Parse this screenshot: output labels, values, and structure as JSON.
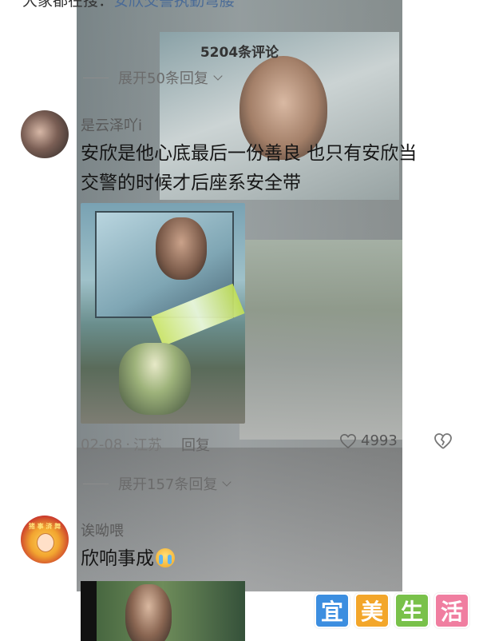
{
  "top_clip": {
    "prefix": "大家都在搜：",
    "query": "安欣交警执勤弯腰"
  },
  "panel": {
    "title": "5204条评论"
  },
  "expand_top": {
    "label": "展开50条回复"
  },
  "comments": [
    {
      "username": "是云泽吖i",
      "text_line1": "安欣是他心底最后一份善良 也只有安欣当",
      "text_line2": "交警的时候才后座系安全带",
      "date": "02-08",
      "location": "江苏",
      "reply_label": "回复",
      "likes": "4993",
      "expand_label": "展开157条回复"
    },
    {
      "username": "诶呦喂",
      "text": "欣响事成",
      "avatar_text": "猪 事 済 舞"
    }
  ],
  "watermark": [
    "宜",
    "美",
    "生",
    "活"
  ],
  "colors": {
    "search_highlight": "#4a6b97",
    "watermark_1": "#3c8ee0",
    "watermark_2": "#f3a62a",
    "watermark_3": "#79c14a",
    "watermark_4": "#f07ea0"
  }
}
